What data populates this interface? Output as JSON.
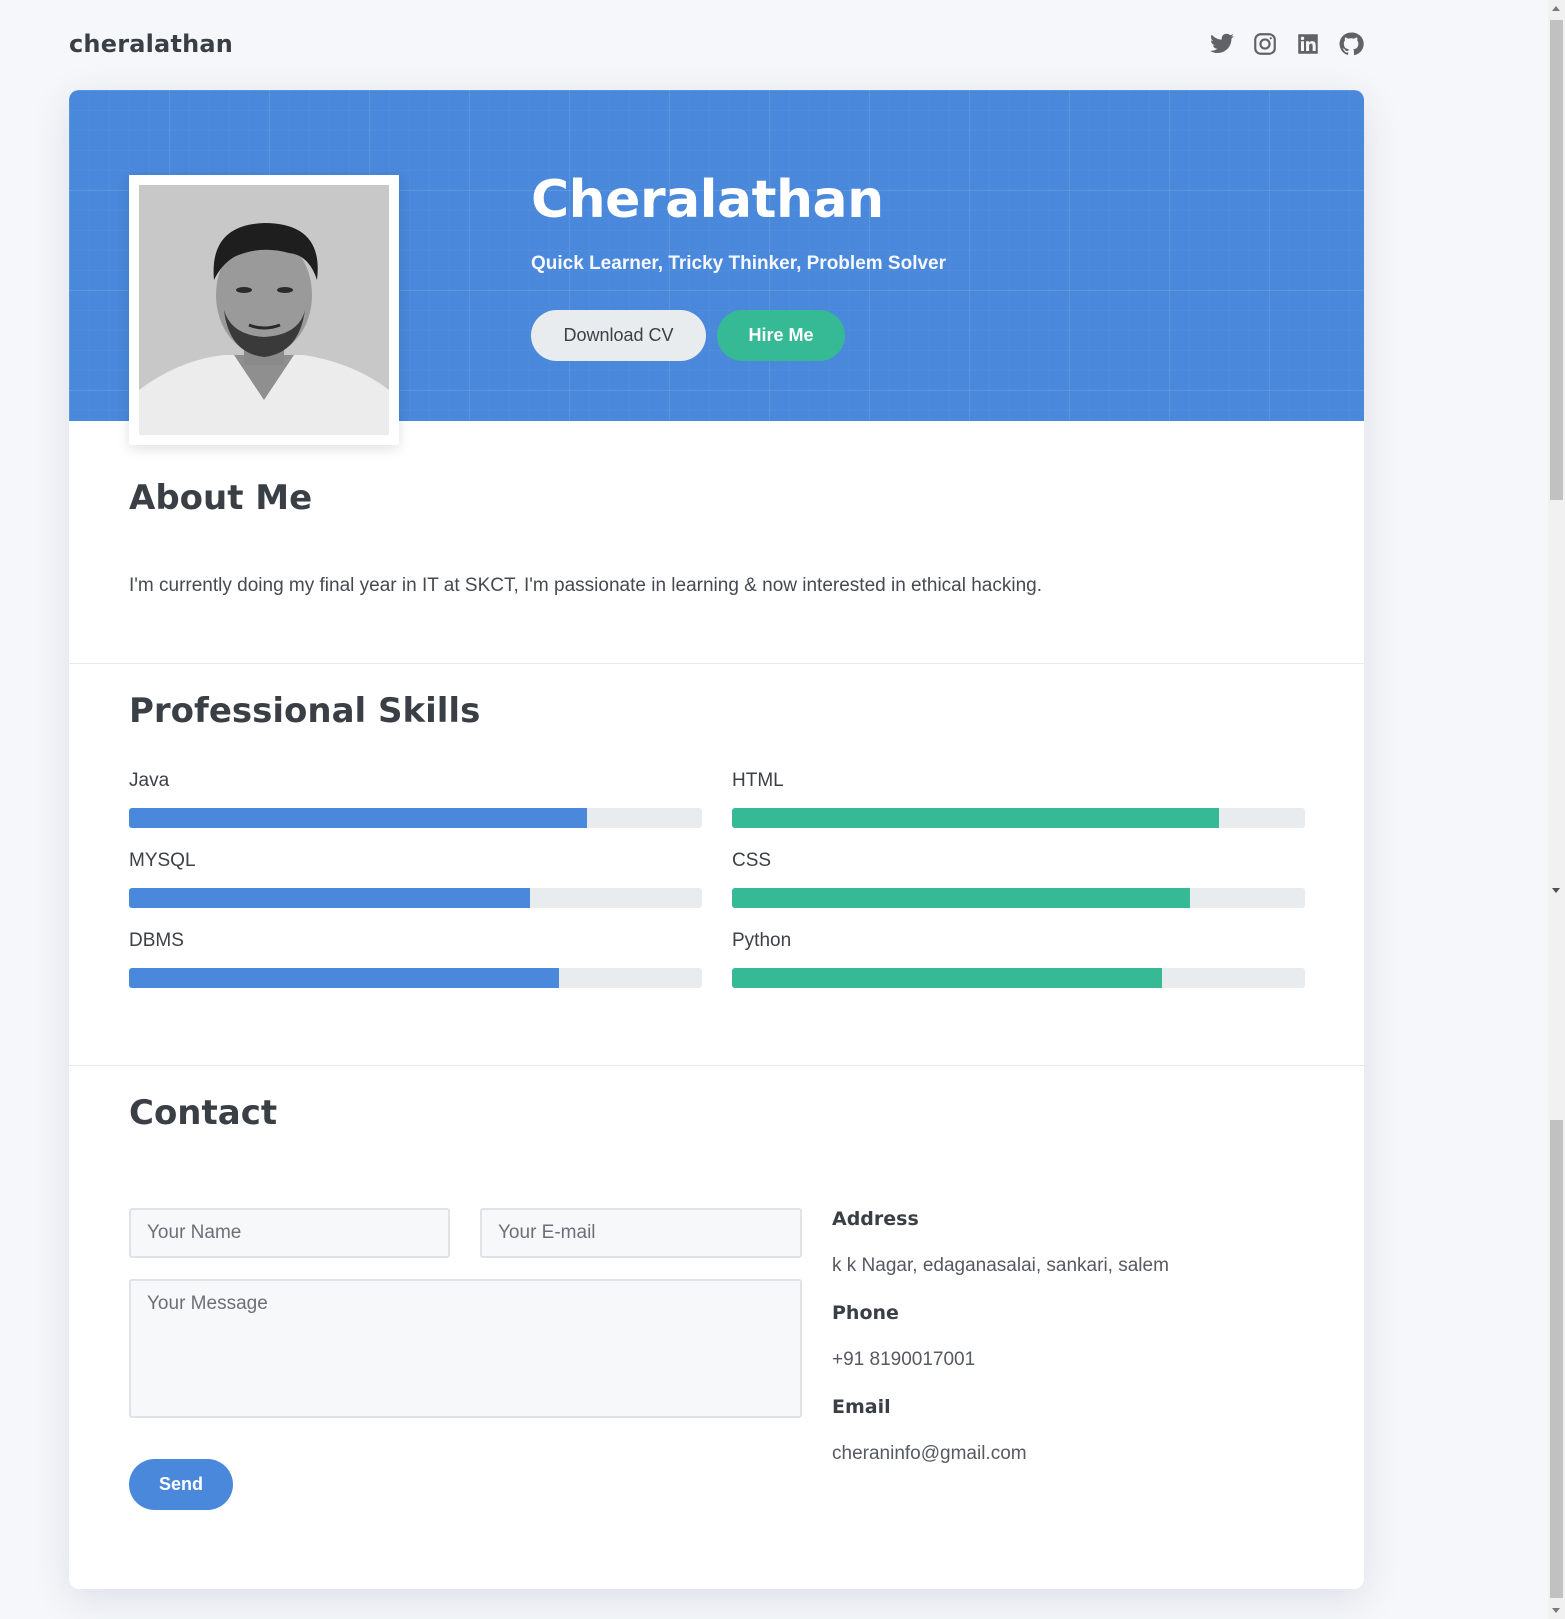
{
  "header": {
    "brand": "cheralathan",
    "social": [
      {
        "icon": "twitter-icon"
      },
      {
        "icon": "instagram-icon"
      },
      {
        "icon": "linkedin-icon"
      },
      {
        "icon": "github-icon"
      }
    ]
  },
  "hero": {
    "name": "Cheralathan",
    "tagline": "Quick Learner, Tricky Thinker, Problem Solver",
    "download_label": "Download CV",
    "hire_label": "Hire Me",
    "accent_color": "#4a88db",
    "hire_color": "#36b995"
  },
  "about": {
    "title": "About Me",
    "text": "I'm currently doing my final year in IT at SKCT, I'm passionate in learning & now interested in ethical hacking."
  },
  "skills": {
    "title": "Professional Skills",
    "left": [
      {
        "name": "Java",
        "percent": 80
      },
      {
        "name": "MYSQL",
        "percent": 70
      },
      {
        "name": "DBMS",
        "percent": 75
      }
    ],
    "right": [
      {
        "name": "HTML",
        "percent": 85
      },
      {
        "name": "CSS",
        "percent": 80
      },
      {
        "name": "Python",
        "percent": 75
      }
    ]
  },
  "contact": {
    "title": "Contact",
    "name_placeholder": "Your Name",
    "email_placeholder": "Your E-mail",
    "message_placeholder": "Your Message",
    "send_label": "Send",
    "address_label": "Address",
    "address": "k k Nagar, edaganasalai, sankari, salem",
    "phone_label": "Phone",
    "phone": "+91 8190017001",
    "email_label": "Email",
    "email": "cheraninfo@gmail.com"
  }
}
